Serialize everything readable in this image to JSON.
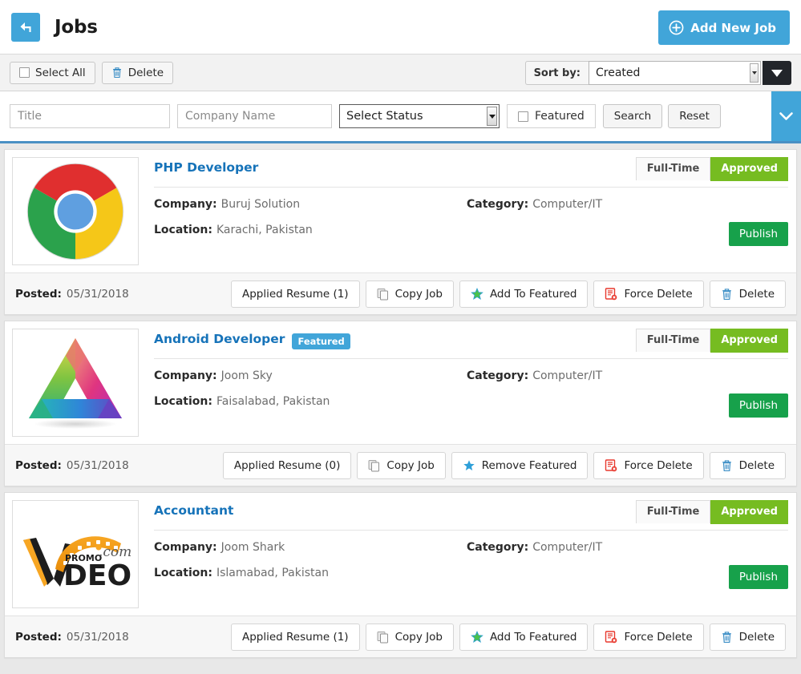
{
  "header": {
    "title": "Jobs",
    "back_icon": "back-arrow-icon",
    "add_button_label": "Add New Job",
    "add_button_icon": "plus-circle-icon",
    "accent_color": "#41a5d9"
  },
  "toolbar": {
    "select_all_label": "Select All",
    "delete_label": "Delete",
    "delete_icon": "trash-icon",
    "sort_label": "Sort by:",
    "sort_value": "Created",
    "sort_options": [
      "Created"
    ],
    "sort_direction_icon": "caret-down-icon"
  },
  "filters": {
    "title_placeholder": "Title",
    "title_value": "",
    "company_placeholder": "Company Name",
    "company_value": "",
    "status_value": "Select Status",
    "status_options": [
      "Select Status"
    ],
    "featured_label": "Featured",
    "featured_checked": false,
    "search_label": "Search",
    "reset_label": "Reset",
    "toggle_icon": "chevron-down-icon"
  },
  "labels": {
    "company": "Company:",
    "location": "Location:",
    "category": "Category:",
    "posted": "Posted:",
    "publish": "Publish",
    "featured_badge": "Featured"
  },
  "colors": {
    "status_approved": "#76bc21",
    "publish": "#17a14b",
    "link": "#1673b9",
    "brand": "#41a5d9"
  },
  "jobs": [
    {
      "title": "PHP Developer",
      "featured": false,
      "featured_badge": "",
      "type": "Full-Time",
      "status": "Approved",
      "company": "Buruj Solution",
      "location": "Karachi, Pakistan",
      "category": "Computer/IT",
      "publish": "Publish",
      "posted": "05/31/2018",
      "logo": "chrome-logo",
      "actions": [
        {
          "label": "Applied Resume (1)",
          "icon": "",
          "name": "applied-resume-button"
        },
        {
          "label": "Copy Job",
          "icon": "copy-icon",
          "name": "copy-job-button"
        },
        {
          "label": "Add To Featured",
          "icon": "star-outline-icon",
          "name": "add-to-featured-button"
        },
        {
          "label": "Force Delete",
          "icon": "force-delete-icon",
          "name": "force-delete-button"
        },
        {
          "label": "Delete",
          "icon": "trash-icon",
          "name": "delete-button"
        }
      ]
    },
    {
      "title": "Android Developer",
      "featured": true,
      "featured_badge": "Featured",
      "type": "Full-Time",
      "status": "Approved",
      "company": "Joom Sky",
      "location": "Faisalabad, Pakistan",
      "category": "Computer/IT",
      "publish": "Publish",
      "posted": "05/31/2018",
      "logo": "triangle-gradient-logo",
      "actions": [
        {
          "label": "Applied Resume (0)",
          "icon": "",
          "name": "applied-resume-button"
        },
        {
          "label": "Copy Job",
          "icon": "copy-icon",
          "name": "copy-job-button"
        },
        {
          "label": "Remove Featured",
          "icon": "star-solid-icon",
          "name": "remove-featured-button"
        },
        {
          "label": "Force Delete",
          "icon": "force-delete-icon",
          "name": "force-delete-button"
        },
        {
          "label": "Delete",
          "icon": "trash-icon",
          "name": "delete-button"
        }
      ]
    },
    {
      "title": "Accountant",
      "featured": false,
      "featured_badge": "",
      "type": "Full-Time",
      "status": "Approved",
      "company": "Joom Shark",
      "location": "Islamabad, Pakistan",
      "category": "Computer/IT",
      "publish": "Publish",
      "posted": "05/31/2018",
      "logo": "video-promo-logo",
      "actions": [
        {
          "label": "Applied Resume (1)",
          "icon": "",
          "name": "applied-resume-button"
        },
        {
          "label": "Copy Job",
          "icon": "copy-icon",
          "name": "copy-job-button"
        },
        {
          "label": "Add To Featured",
          "icon": "star-outline-icon",
          "name": "add-to-featured-button"
        },
        {
          "label": "Force Delete",
          "icon": "force-delete-icon",
          "name": "force-delete-button"
        },
        {
          "label": "Delete",
          "icon": "trash-icon",
          "name": "delete-button"
        }
      ]
    }
  ]
}
